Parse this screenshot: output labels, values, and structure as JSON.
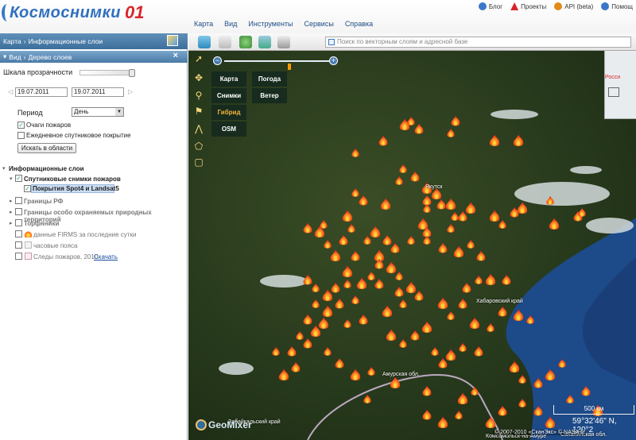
{
  "header": {
    "logo_text": "Космоснимки",
    "logo_num": "01",
    "links": [
      {
        "icon": "rss-icon",
        "label": "Блог"
      },
      {
        "icon": "triangle-logo-icon",
        "label": "Проекты"
      },
      {
        "icon": "gear-icon",
        "label": "API (beta)"
      },
      {
        "icon": "globe-icon",
        "label": "Помощ"
      }
    ],
    "menu": [
      "Карта",
      "Вид",
      "Инструменты",
      "Сервисы",
      "Справка"
    ]
  },
  "sidebar": {
    "breadcrumb": [
      "Карта",
      "Информационные слои"
    ],
    "tree_path": [
      "Вид",
      "Дерево слоев"
    ],
    "close_label": "×",
    "opacity_label": "Шкала прозрачности",
    "opacity_level": 1.0,
    "date_from": "19.07.2011",
    "date_to": "19.07.2011",
    "period_label": "Период",
    "period_value": "День",
    "checkboxes": [
      {
        "label": "Очаги пожаров",
        "checked": true
      },
      {
        "label": "Ежедневное спутниковое покрытие",
        "checked": false
      }
    ],
    "search_button": "Искать в области",
    "layers_title": "Информационные слои",
    "layers": [
      {
        "label": "Спутниковые снимки пожаров",
        "checked": true
      },
      {
        "label": "Покрытия Spot4 и Landsat5",
        "checked": true
      },
      {
        "label": "Границы РФ",
        "checked": false
      },
      {
        "label": "Границы особо охраняемых природных территорий",
        "checked": false
      },
      {
        "label": "Торфяники",
        "checked": false
      },
      {
        "label": "данные FIRMS за последние сутки",
        "checked": false
      },
      {
        "label": "часовые пояса",
        "checked": false
      },
      {
        "label": "Следы пожаров, 2010",
        "checked": false
      }
    ],
    "download_link": "Скачать"
  },
  "map": {
    "search_placeholder": "Поиск по векторным слоям и адресной базе",
    "basemaps": [
      {
        "label": "Карта",
        "active": false
      },
      {
        "label": "Снимки",
        "active": false
      },
      {
        "label": "Гибрид",
        "active": true
      },
      {
        "label": "OSM",
        "active": false
      },
      {
        "label": "Погода",
        "active": false
      },
      {
        "label": "Ветер",
        "active": false
      }
    ],
    "zoom_in": "+",
    "zoom_out": "−",
    "overview_label": "Росси",
    "scale": "500 км",
    "coords": "59°32'46\" N, 120°2",
    "copyright": "© 2007-2010 «СканЭкс» © NASA © ",
    "geomixer_label": "GeoMixer",
    "places": [
      {
        "name": "Якутск"
      },
      {
        "name": "Хабаровский край"
      },
      {
        "name": "Амурская обл."
      },
      {
        "name": "Забайкальский край"
      },
      {
        "name": "Комсомольск-на-Амуре"
      },
      {
        "name": "Сахалинская обл."
      }
    ],
    "colors": {
      "fire": "#ff5a1a",
      "fire_core": "#ffd23a",
      "sea": "#1d4a88",
      "land": "#26391e"
    }
  }
}
